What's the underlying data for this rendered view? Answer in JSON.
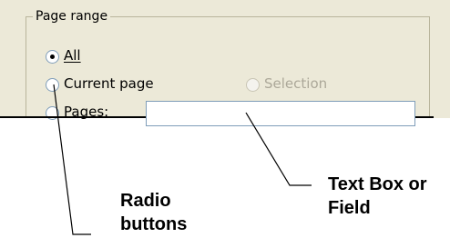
{
  "group": {
    "legend": "Page range"
  },
  "options": [
    {
      "label": "All",
      "checked": true,
      "disabled": false
    },
    {
      "label": "Current page",
      "checked": false,
      "disabled": false
    },
    {
      "label": "Selection",
      "checked": false,
      "disabled": true
    },
    {
      "label": "Pages:",
      "checked": false,
      "disabled": false
    }
  ],
  "pages_field": {
    "value": ""
  },
  "callouts": {
    "radio_buttons": "Radio\nbuttons",
    "text_box": "Text Box or\nField"
  }
}
